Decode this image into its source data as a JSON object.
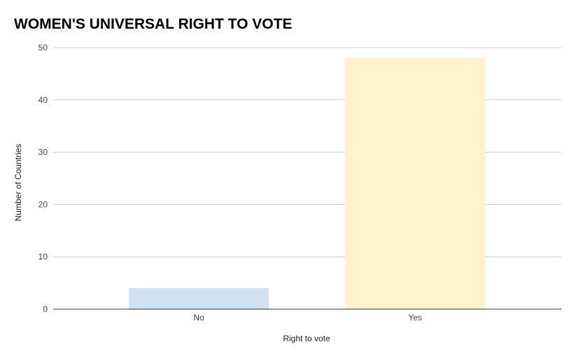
{
  "chart_data": {
    "type": "bar",
    "title": "WOMEN'S UNIVERSAL RIGHT TO VOTE",
    "xlabel": "Right to vote",
    "ylabel": "Number of Countries",
    "categories": [
      "No",
      "Yes"
    ],
    "values": [
      4,
      48
    ],
    "bar_colors": [
      "#cfe2f3",
      "#fff2cc"
    ],
    "ylim": [
      0,
      50
    ],
    "yticks": [
      "0",
      "10",
      "20",
      "30",
      "40",
      "50"
    ],
    "grid": true,
    "legend": "none"
  }
}
